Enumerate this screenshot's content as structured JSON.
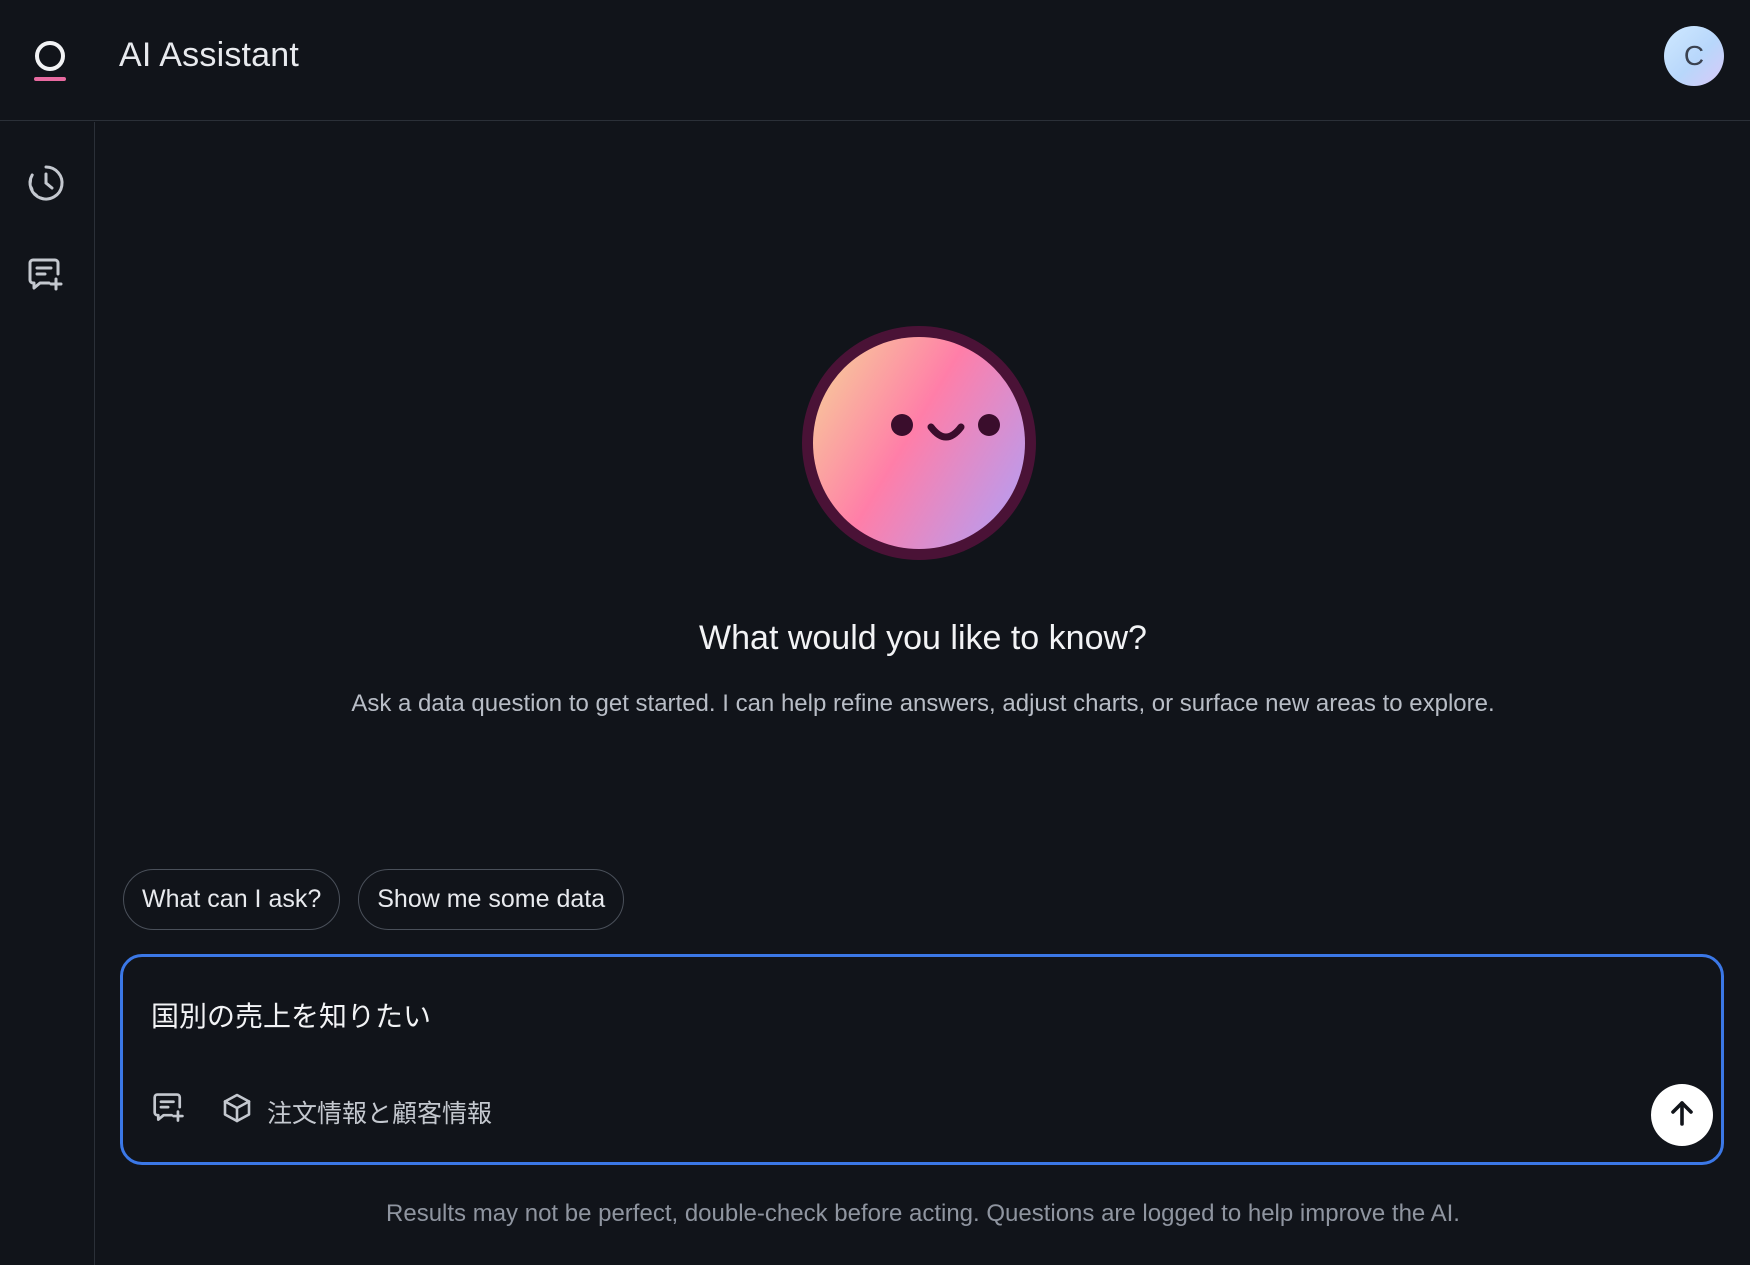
{
  "header": {
    "title": "AI Assistant",
    "logo_icon": "assistant-logo-icon",
    "avatar_initial": "C"
  },
  "sidebar": {
    "items": [
      {
        "name": "history",
        "icon": "history-clock-icon"
      },
      {
        "name": "new-chat",
        "icon": "new-chat-icon"
      }
    ]
  },
  "main": {
    "mascot_icon": "smiling-face-mascot",
    "title": "What would you like to know?",
    "subtitle": "Ask a data question to get started. I can help refine answers, adjust charts, or surface new areas to explore.",
    "suggestions": [
      "What can I ask?",
      "Show me some data"
    ],
    "composer": {
      "value": "国別の売上を知りたい",
      "new_chat_icon": "new-chat-icon",
      "source_icon": "cube-icon",
      "source_label": "注文情報と顧客情報",
      "send_icon": "arrow-up-icon"
    },
    "disclaimer": "Results may not be perfect, double-check before acting. Questions are logged to help improve the AI."
  },
  "colors": {
    "background": "#11141a",
    "border": "#2b3038",
    "accent": "#3b78e7",
    "logo_accent": "#e86aa0"
  }
}
